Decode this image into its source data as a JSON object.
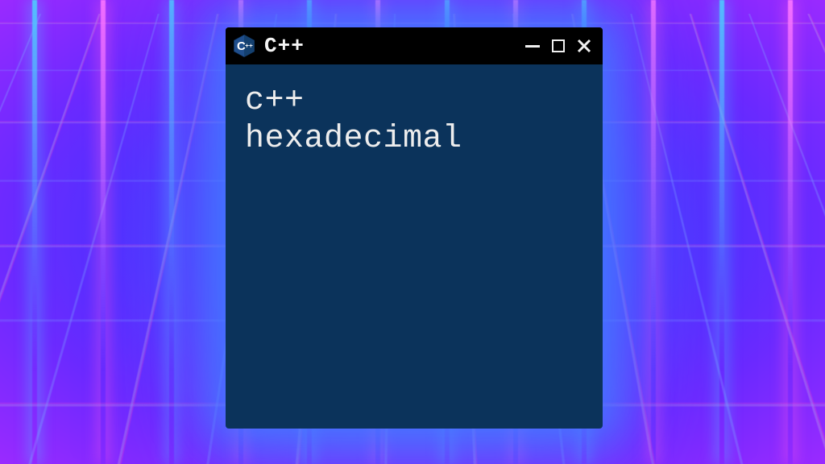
{
  "window": {
    "title": "C++",
    "content_line1": "c++",
    "content_line2": "hexadecimal",
    "colors": {
      "titlebar_bg": "#000000",
      "client_bg": "#0b335b",
      "text": "#ededed"
    }
  },
  "icons": {
    "app": "cpp-hex-icon",
    "minimize": "minimize-icon",
    "maximize": "maximize-icon",
    "close": "close-icon"
  }
}
